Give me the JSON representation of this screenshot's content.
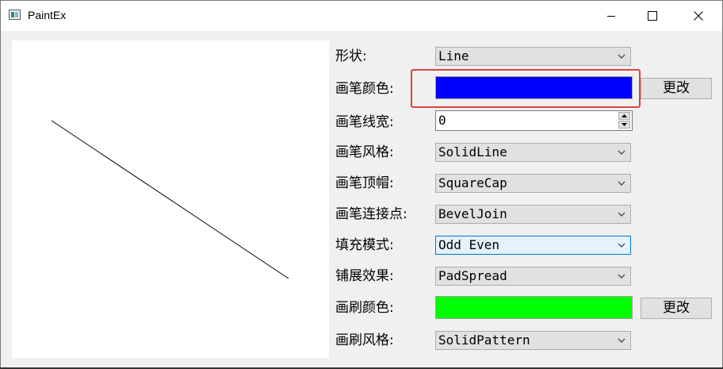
{
  "window": {
    "title": "PaintEx"
  },
  "titlebar": {
    "min_icon": "minimize-icon",
    "max_icon": "maximize-icon",
    "close_icon": "close-icon"
  },
  "form": {
    "shape_label": "形状:",
    "shape_value": "Line",
    "pen_color_label": "画笔颜色:",
    "pen_color": "#0000ff",
    "pen_color_button": "更改",
    "pen_width_label": "画笔线宽:",
    "pen_width_value": "0",
    "pen_style_label": "画笔风格:",
    "pen_style_value": "SolidLine",
    "pen_cap_label": "画笔顶帽:",
    "pen_cap_value": "SquareCap",
    "pen_join_label": "画笔连接点:",
    "pen_join_value": "BevelJoin",
    "fill_mode_label": "填充模式:",
    "fill_mode_value": "Odd Even",
    "spread_label": "铺展效果:",
    "spread_value": "PadSpread",
    "brush_color_label": "画刷颜色:",
    "brush_color": "#00ff00",
    "brush_color_button": "更改",
    "brush_style_label": "画刷风格:",
    "brush_style_value": "SolidPattern"
  },
  "colors": {
    "highlight_box": "#e0423b",
    "active_border": "#0078d7"
  }
}
